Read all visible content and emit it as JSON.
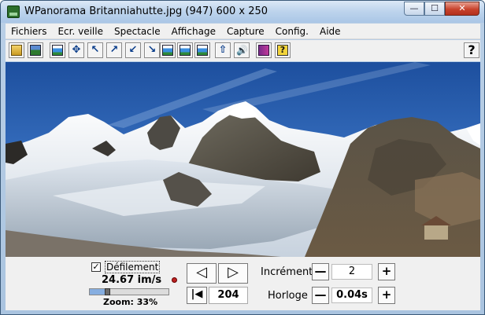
{
  "window": {
    "title": "WPanorama  Britanniahutte.jpg  (947) 600 x 250",
    "controls": {
      "minimize": "—",
      "maximize": "☐",
      "close": "✕"
    }
  },
  "menu": [
    "Fichiers",
    "Ecr. veille",
    "Spectacle",
    "Affichage",
    "Capture",
    "Config.",
    "Aide"
  ],
  "toolbar": {
    "icons": [
      "open-folder-icon",
      "picture-icon",
      "page-icon",
      "move-arrows-icon",
      "arrow-up-left-icon",
      "arrow-up-right-icon",
      "arrow-down-left-icon",
      "arrow-down-right-icon",
      "panorama-icon",
      "panorama-blue-icon",
      "panorama-small-icon",
      "upload-icon",
      "speaker-icon",
      "book-icon",
      "help-book-icon"
    ],
    "help_label": "?"
  },
  "controls": {
    "scroll_label": "Défilement",
    "scroll_checked": "✓",
    "speed": "24.67 im/s",
    "zoom": "Zoom: 33%",
    "slider_level": 0.22,
    "prev": "◁",
    "next": "▷",
    "first": "|◀",
    "frame": "204",
    "increment_label": "Incrément",
    "increment_value": "2",
    "clock_label": "Horloge",
    "clock_value": "0.04s",
    "minus": "—",
    "plus": "+"
  },
  "colors": {
    "title_gradient": "#bcd3ec",
    "panel": "#f0f0f0",
    "close_red": "#c8432c"
  }
}
